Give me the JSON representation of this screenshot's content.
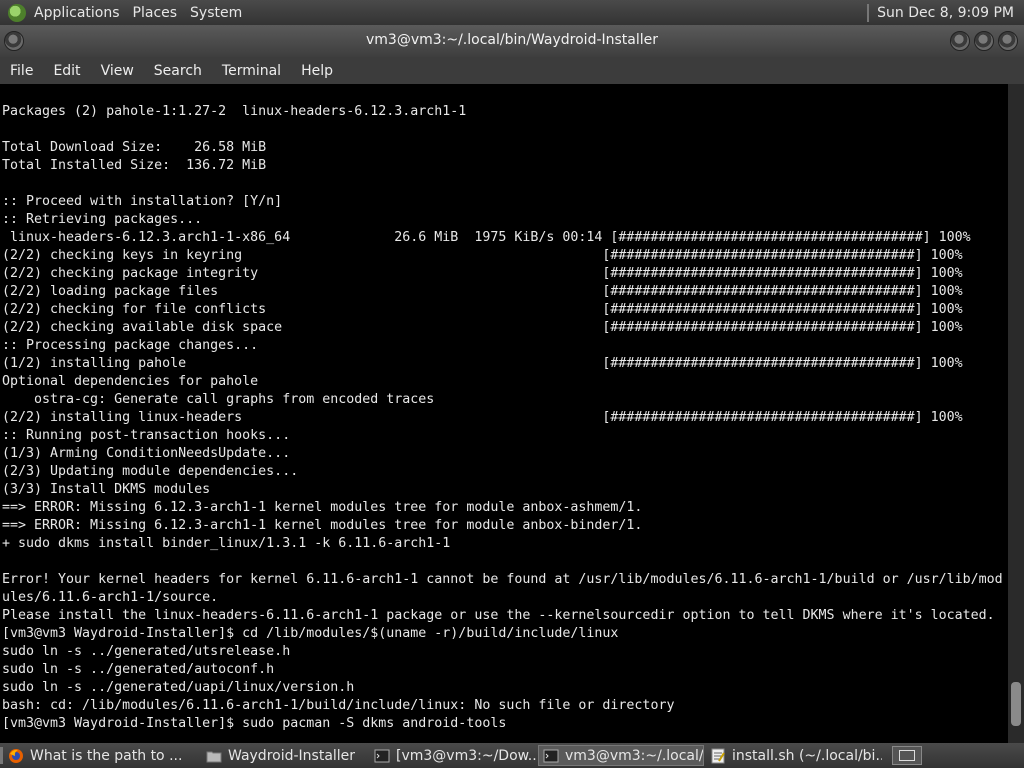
{
  "top_panel": {
    "menus": [
      "Applications",
      "Places",
      "System"
    ],
    "clock": "Sun Dec 8,  9:09 PM"
  },
  "window": {
    "title": "vm3@vm3:~/.local/bin/Waydroid-Installer"
  },
  "menubar": [
    "File",
    "Edit",
    "View",
    "Search",
    "Terminal",
    "Help"
  ],
  "terminal": {
    "lines": [
      "Packages (2) pahole-1:1.27-2  linux-headers-6.12.3.arch1-1",
      "",
      "Total Download Size:    26.58 MiB",
      "Total Installed Size:  136.72 MiB",
      "",
      ":: Proceed with installation? [Y/n]",
      ":: Retrieving packages...",
      " linux-headers-6.12.3.arch1-1-x86_64             26.6 MiB  1975 KiB/s 00:14 [######################################] 100%",
      "(2/2) checking keys in keyring                                             [######################################] 100%",
      "(2/2) checking package integrity                                           [######################################] 100%",
      "(2/2) loading package files                                                [######################################] 100%",
      "(2/2) checking for file conflicts                                          [######################################] 100%",
      "(2/2) checking available disk space                                        [######################################] 100%",
      ":: Processing package changes...",
      "(1/2) installing pahole                                                    [######################################] 100%",
      "Optional dependencies for pahole",
      "    ostra-cg: Generate call graphs from encoded traces",
      "(2/2) installing linux-headers                                             [######################################] 100%",
      ":: Running post-transaction hooks...",
      "(1/3) Arming ConditionNeedsUpdate...",
      "(2/3) Updating module dependencies...",
      "(3/3) Install DKMS modules",
      "==> ERROR: Missing 6.12.3-arch1-1 kernel modules tree for module anbox-ashmem/1.",
      "==> ERROR: Missing 6.12.3-arch1-1 kernel modules tree for module anbox-binder/1.",
      "+ sudo dkms install binder_linux/1.3.1 -k 6.11.6-arch1-1",
      "",
      "Error! Your kernel headers for kernel 6.11.6-arch1-1 cannot be found at /usr/lib/modules/6.11.6-arch1-1/build or /usr/lib/mod",
      "ules/6.11.6-arch1-1/source.",
      "Please install the linux-headers-6.11.6-arch1-1 package or use the --kernelsourcedir option to tell DKMS where it's located.",
      "[vm3@vm3 Waydroid-Installer]$ cd /lib/modules/$(uname -r)/build/include/linux",
      "sudo ln -s ../generated/utsrelease.h",
      "sudo ln -s ../generated/autoconf.h",
      "sudo ln -s ../generated/uapi/linux/version.h",
      "bash: cd: /lib/modules/6.11.6-arch1-1/build/include/linux: No such file or directory",
      "[vm3@vm3 Waydroid-Installer]$ sudo pacman -S dkms android-tools"
    ]
  },
  "taskbar": {
    "tasks": [
      {
        "label": "What is the path to ...",
        "icon": "firefox-icon",
        "active": false
      },
      {
        "label": "Waydroid-Installer",
        "icon": "folder-icon",
        "active": false
      },
      {
        "label": "[vm3@vm3:~/Dow...",
        "icon": "terminal-icon",
        "active": false
      },
      {
        "label": "vm3@vm3:~/.local/...",
        "icon": "terminal-icon",
        "active": true
      },
      {
        "label": "install.sh (~/.local/bi...",
        "icon": "text-editor-icon",
        "active": false
      }
    ]
  },
  "colors": {
    "panel": "#3c3c3c",
    "terminal_bg": "#000000",
    "terminal_fg": "#e8e8e8"
  }
}
